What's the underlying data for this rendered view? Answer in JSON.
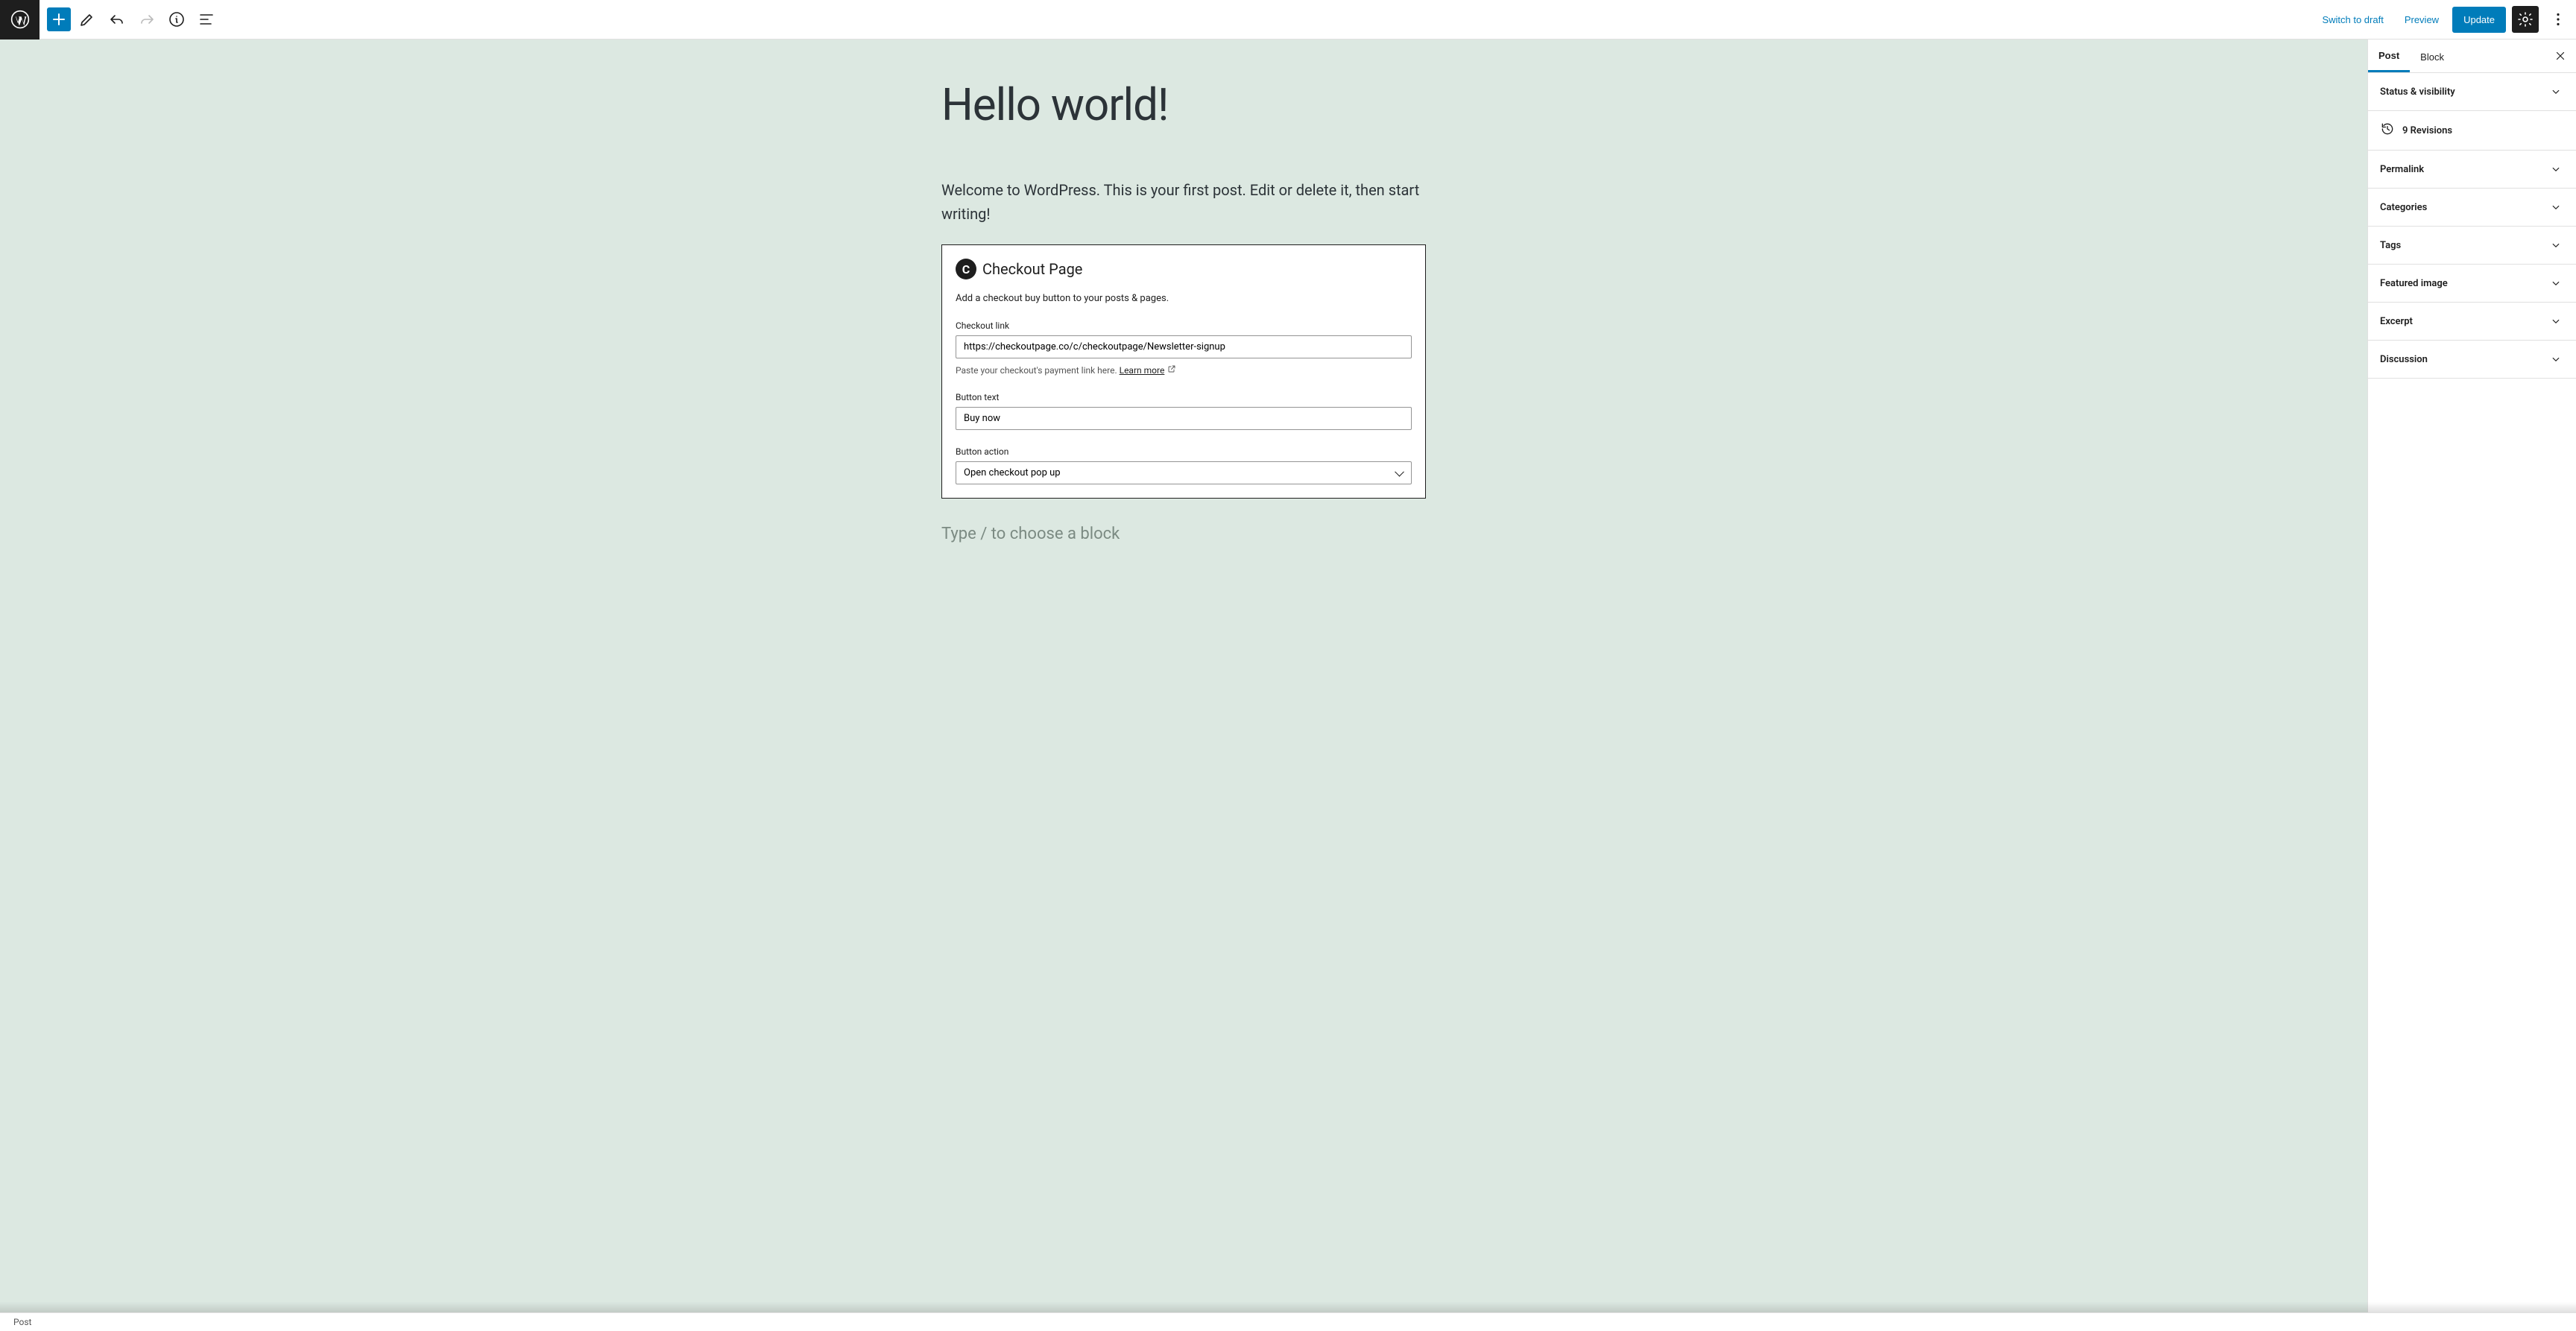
{
  "toolbar": {
    "switch_to_draft": "Switch to draft",
    "preview": "Preview",
    "update": "Update"
  },
  "sidebar": {
    "tabs": {
      "post": "Post",
      "block": "Block"
    },
    "panels": {
      "status": "Status & visibility",
      "permalink": "Permalink",
      "categories": "Categories",
      "tags": "Tags",
      "featured": "Featured image",
      "excerpt": "Excerpt",
      "discussion": "Discussion"
    },
    "revisions": "9 Revisions"
  },
  "post": {
    "title": "Hello world!",
    "paragraph": "Welcome to WordPress. This is your first post. Edit or delete it, then start writing!"
  },
  "block": {
    "title": "Checkout Page",
    "description": "Add a checkout buy button to your posts & pages.",
    "checkout_link_label": "Checkout link",
    "checkout_link_value": "https://checkoutpage.co/c/checkoutpage/Newsletter-signup",
    "checkout_link_help": "Paste your checkout's payment link here. ",
    "learn_more": "Learn more",
    "button_text_label": "Button text",
    "button_text_value": "Buy now",
    "button_action_label": "Button action",
    "button_action_value": "Open checkout pop up"
  },
  "editor": {
    "block_placeholder": "Type / to choose a block"
  },
  "status": {
    "breadcrumb": "Post"
  }
}
